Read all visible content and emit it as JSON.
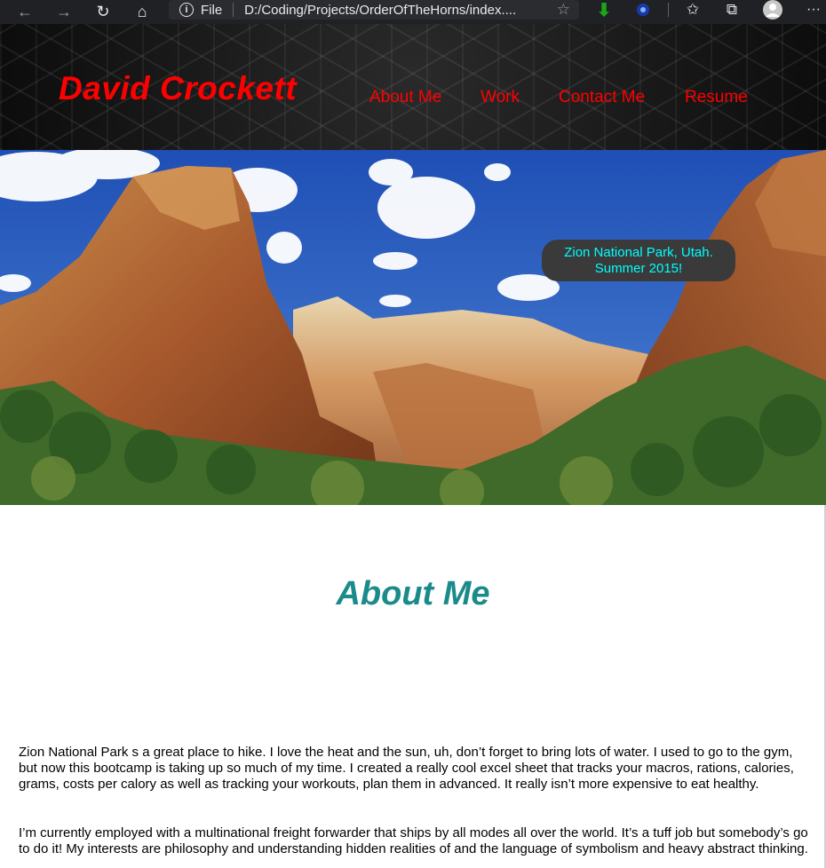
{
  "browser": {
    "file_label": "File",
    "url": "D:/Coding/Projects/OrderOfTheHorns/index...."
  },
  "site": {
    "brand": "David Crockett",
    "nav": [
      "About Me",
      "Work",
      "Contact Me",
      "Resume"
    ]
  },
  "hero": {
    "caption_line1": "Zion National Park, Utah.",
    "caption_line2": "Summer 2015!"
  },
  "about": {
    "title": "About Me",
    "paragraph1": "Zion National Park s a great place to hike. I love the heat and the sun, uh, don’t forget to bring lots of water. I used to go to the gym, but now this bootcamp is taking up so much of my time. I created a really cool excel sheet that tracks your macros, rations, calories, grams, costs per calory as well as tracking your workouts, plan them in advanced. It really isn’t more expensive to eat healthy.",
    "paragraph2": "I’m currently employed with a multinational freight forwarder that ships by all modes all over the world. It’s a tuff job but somebody’s go to do it! My interests are philosophy and understanding hidden realities of and the language of symbolism and heavy abstract thinking."
  }
}
